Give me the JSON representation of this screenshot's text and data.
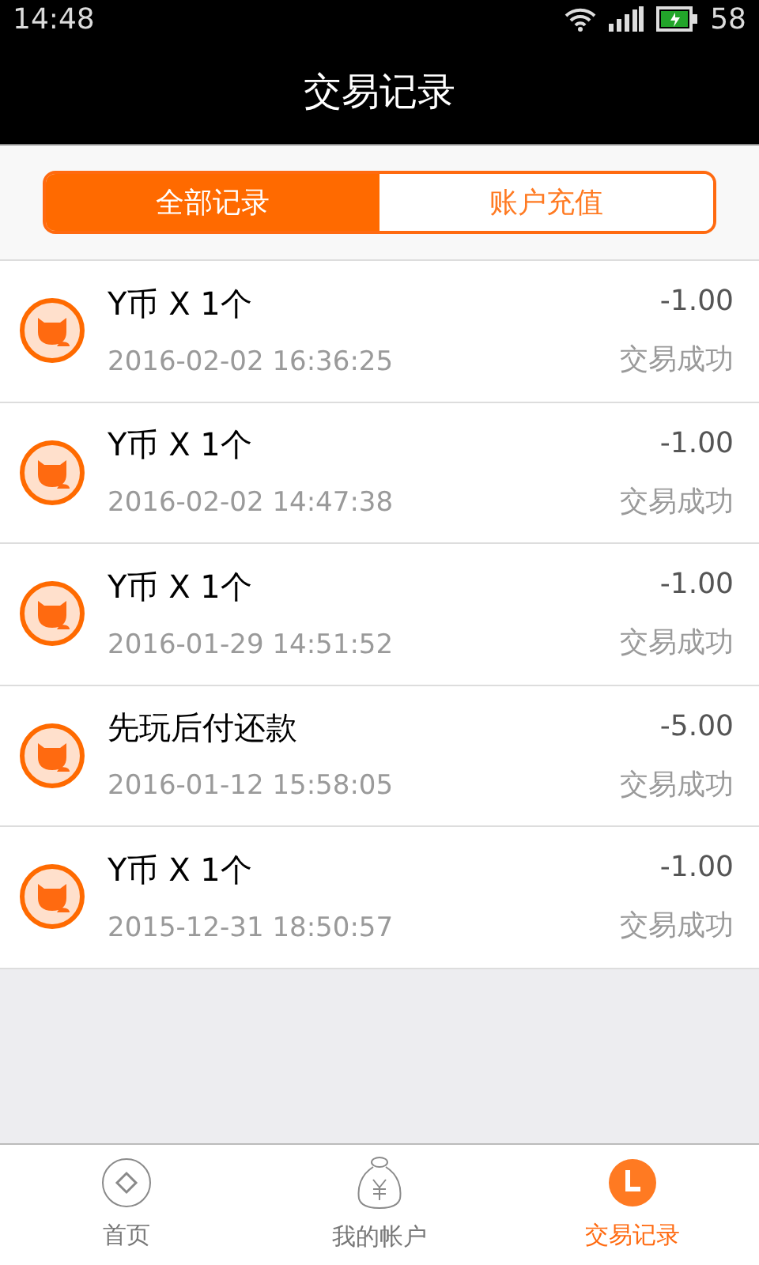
{
  "status_bar": {
    "time": "14:48",
    "battery": "58"
  },
  "header": {
    "title": "交易记录"
  },
  "segments": [
    {
      "label": "全部记录",
      "selected": true
    },
    {
      "label": "账户充值",
      "selected": false
    }
  ],
  "transactions": [
    {
      "name": "Y币 X 1个",
      "time": "2016-02-02 16:36:25",
      "amount": "-1.00",
      "status": "交易成功"
    },
    {
      "name": "Y币 X 1个",
      "time": "2016-02-02 14:47:38",
      "amount": "-1.00",
      "status": "交易成功"
    },
    {
      "name": "Y币 X 1个",
      "time": "2016-01-29 14:51:52",
      "amount": "-1.00",
      "status": "交易成功"
    },
    {
      "name": "先玩后付还款",
      "time": "2016-01-12 15:58:05",
      "amount": "-5.00",
      "status": "交易成功"
    },
    {
      "name": "Y币 X 1个",
      "time": "2015-12-31 18:50:57",
      "amount": "-1.00",
      "status": "交易成功"
    }
  ],
  "tab_bar": [
    {
      "label": "首页",
      "selected": false
    },
    {
      "label": "我的帐户",
      "selected": false
    },
    {
      "label": "交易记录",
      "selected": true
    }
  ]
}
